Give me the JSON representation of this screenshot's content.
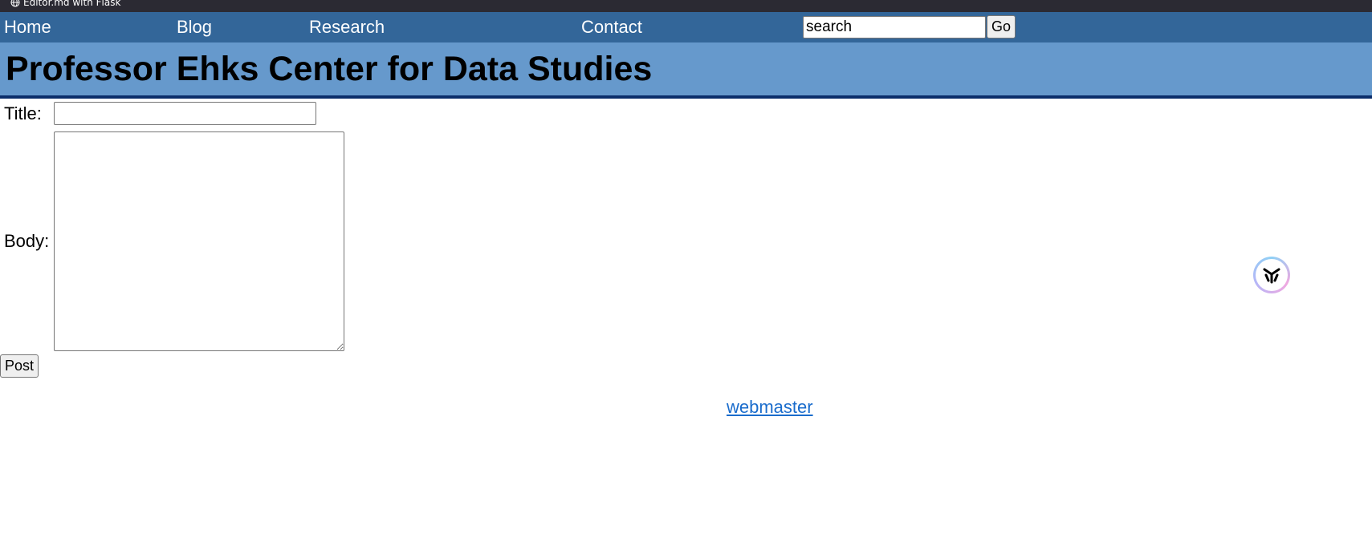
{
  "browser": {
    "tab_title": "Editor.md with Flask",
    "tab_icon": "globe-icon"
  },
  "nav": {
    "items": [
      {
        "label": "Home"
      },
      {
        "label": "Blog"
      },
      {
        "label": "Research"
      },
      {
        "label": "Contact"
      }
    ],
    "search": {
      "value": "search",
      "button_label": "Go"
    }
  },
  "header": {
    "title": "Professor Ehks Center for Data Studies"
  },
  "form": {
    "title_label": "Title:",
    "title_value": "",
    "body_label": "Body:",
    "body_value": "",
    "submit_label": "Post"
  },
  "footer": {
    "link_label": "webmaster"
  },
  "widget": {
    "icon": "assistant-icon"
  },
  "colors": {
    "nav_bg": "#336699",
    "header_bg": "#6699cc",
    "header_border": "#0b2e6b",
    "link": "#1a6ccc",
    "browser_chrome": "#2b2a33"
  }
}
